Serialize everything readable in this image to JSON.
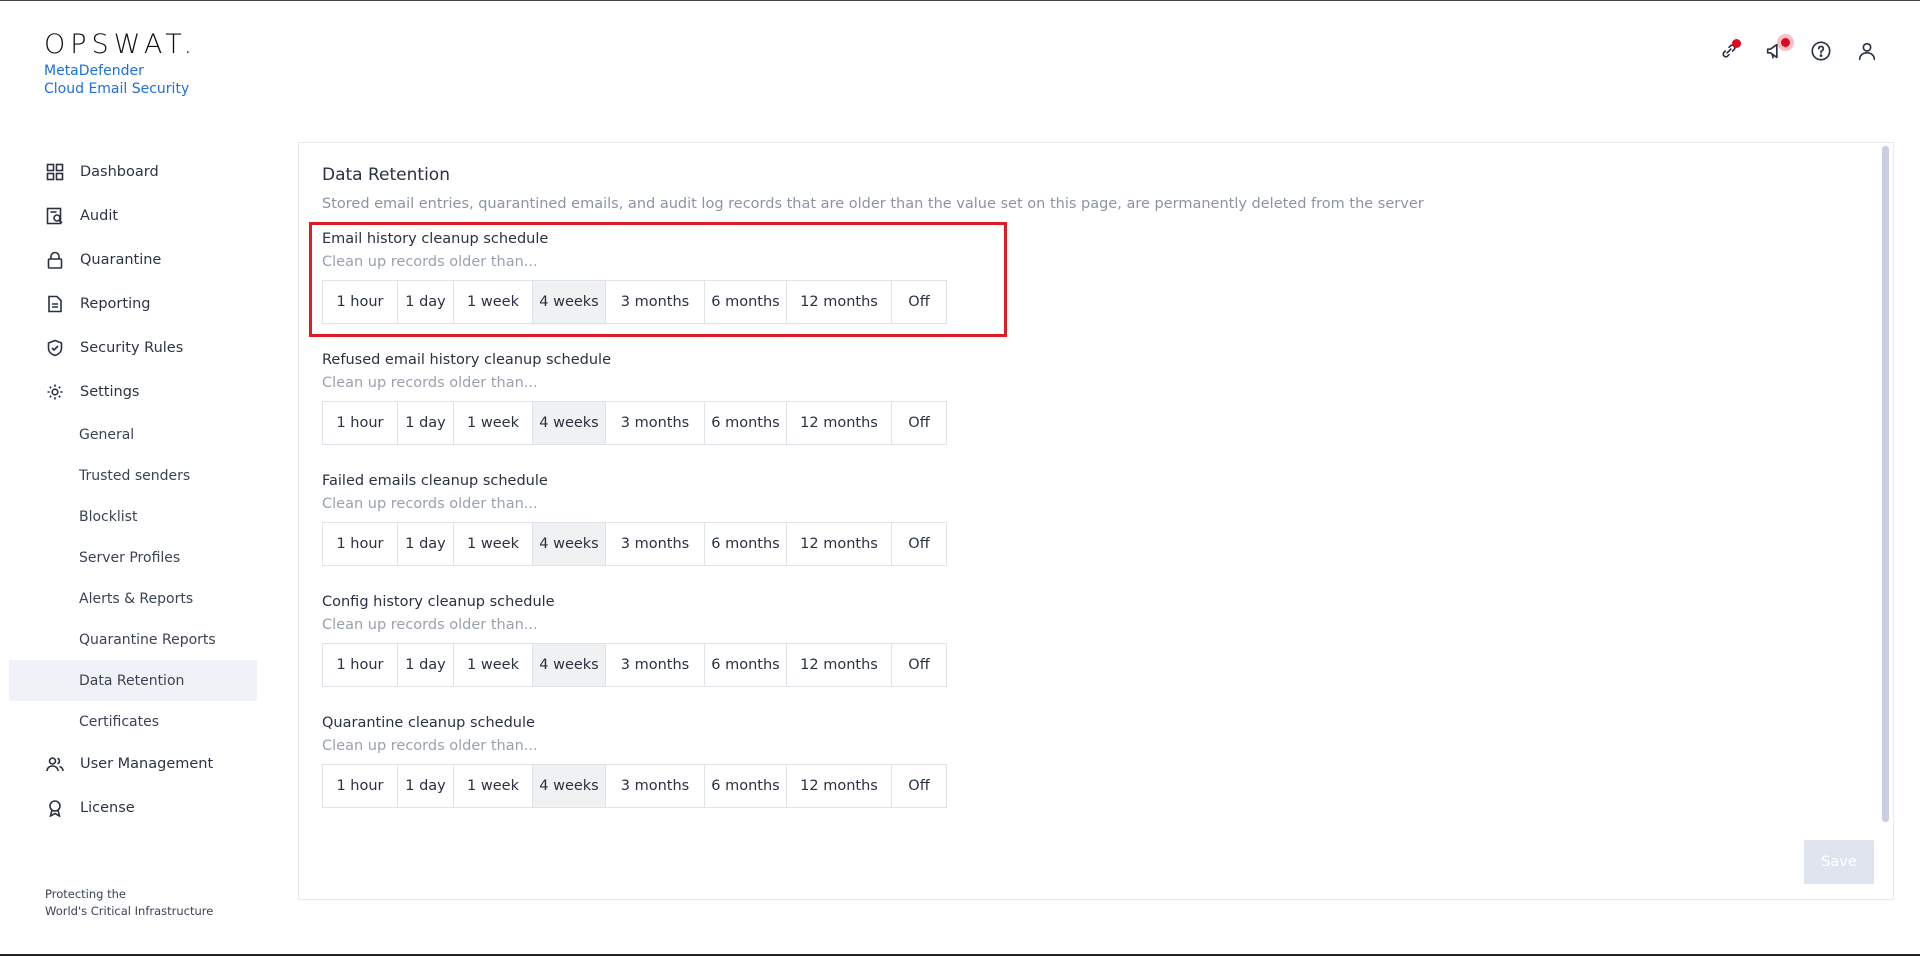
{
  "brand": {
    "logo_text": "OPSWAT.",
    "product_line1": "MetaDefender",
    "product_line2": "Cloud Email Security",
    "tagline_line1": "Protecting the",
    "tagline_line2": "World's Critical Infrastructure"
  },
  "header": {
    "icons": [
      "link-icon",
      "announcement-icon",
      "help-icon",
      "user-icon"
    ],
    "notification_color": "#e0091c"
  },
  "sidebar": {
    "items": [
      {
        "label": "Dashboard",
        "icon": "dashboard-icon"
      },
      {
        "label": "Audit",
        "icon": "audit-icon"
      },
      {
        "label": "Quarantine",
        "icon": "lock-icon"
      },
      {
        "label": "Reporting",
        "icon": "document-icon"
      },
      {
        "label": "Security Rules",
        "icon": "shield-check-icon"
      },
      {
        "label": "Settings",
        "icon": "gear-icon"
      }
    ],
    "settings_sub": [
      {
        "label": "General"
      },
      {
        "label": "Trusted senders"
      },
      {
        "label": "Blocklist"
      },
      {
        "label": "Server Profiles"
      },
      {
        "label": "Alerts & Reports"
      },
      {
        "label": "Quarantine Reports"
      },
      {
        "label": "Data Retention"
      },
      {
        "label": "Certificates"
      }
    ],
    "active_sub": "Data Retention",
    "bottom_items": [
      {
        "label": "User Management",
        "icon": "users-icon"
      },
      {
        "label": "License",
        "icon": "award-icon"
      }
    ]
  },
  "main": {
    "title": "Data Retention",
    "description": "Stored email entries, quarantined emails, and audit log records that are older than the value set on this page, are permanently deleted from the server",
    "options": [
      "1 hour",
      "1 day",
      "1 week",
      "4 weeks",
      "3 months",
      "6 months",
      "12 months",
      "Off"
    ],
    "sections": [
      {
        "title": "Email history cleanup schedule",
        "subtitle": "Clean up records older than...",
        "selected": "4 weeks"
      },
      {
        "title": "Refused email history cleanup schedule",
        "subtitle": "Clean up records older than...",
        "selected": "4 weeks"
      },
      {
        "title": "Failed emails cleanup schedule",
        "subtitle": "Clean up records older than...",
        "selected": "4 weeks"
      },
      {
        "title": "Config history cleanup schedule",
        "subtitle": "Clean up records older than...",
        "selected": "4 weeks"
      },
      {
        "title": "Quarantine cleanup schedule",
        "subtitle": "Clean up records older than...",
        "selected": "4 weeks"
      }
    ],
    "save_label": "Save",
    "highlight_color": "#e01b24"
  }
}
